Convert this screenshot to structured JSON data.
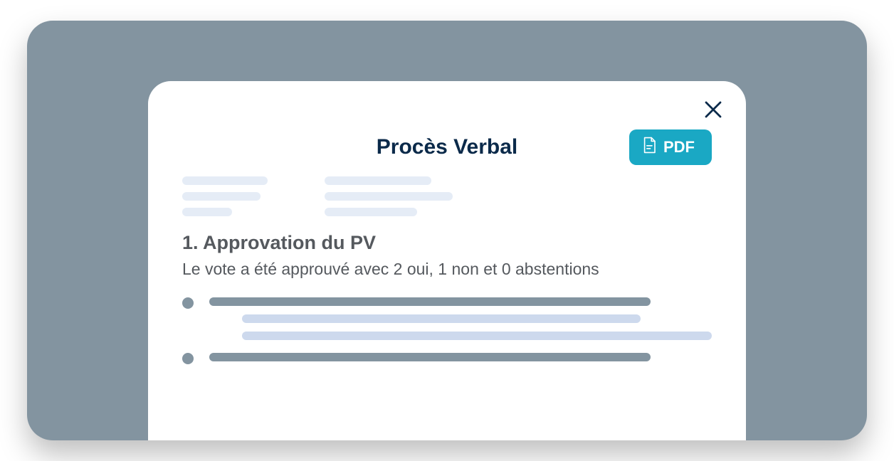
{
  "modal": {
    "title": "Procès Verbal",
    "pdf_button_label": "PDF"
  },
  "section": {
    "heading": "1. Approvation du PV",
    "body": "Le vote a été approuvé avec 2 oui, 1 non et 0 abstentions"
  },
  "colors": {
    "frame_bg": "#8394a0",
    "accent": "#1aa8c4",
    "heading": "#0b2a4a",
    "placeholder_light": "#e5ecf6",
    "placeholder_blue": "#cdd9ed"
  }
}
